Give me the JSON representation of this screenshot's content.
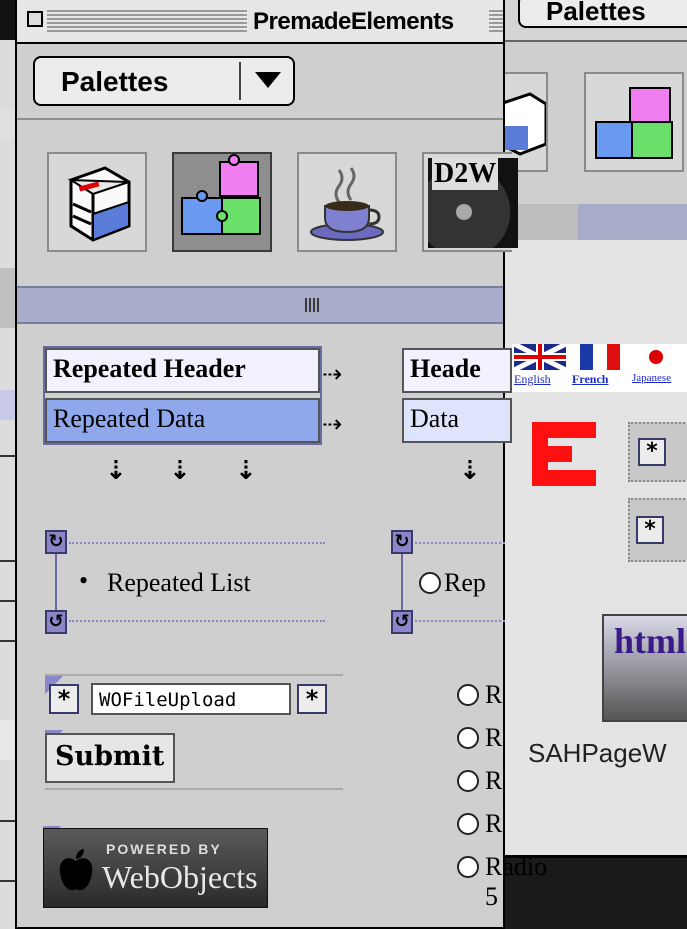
{
  "window": {
    "title": "PremadeElements"
  },
  "palette_dropdown": {
    "selected": "Palettes"
  },
  "toolbar": {
    "icons": [
      "database-cube-icon",
      "puzzle-pieces-icon",
      "java-coffee-cup-icon",
      "d2w-web-icon"
    ],
    "d2w_label": "D2W"
  },
  "repetition": {
    "header_label": "Repeated Header",
    "data_label": "Repeated Data",
    "header2_label": "Heade",
    "data2_label": "Data"
  },
  "repeated_list": {
    "item_label": "Repeated List",
    "item2_label": "Rep"
  },
  "file_upload": {
    "field_value": "WOFileUpload",
    "submit_label": "Submit"
  },
  "radio_group": {
    "items": [
      "R",
      "R",
      "R",
      "R",
      "Radio 5"
    ]
  },
  "badge": {
    "powered_by": "POWERED BY",
    "brand": "WebObjects"
  },
  "second_window": {
    "button_label": "Palettes",
    "flags": [
      "English",
      "French",
      "Japanese"
    ],
    "html_label": "html",
    "component_label": "SAHPageW"
  },
  "colors": {
    "window_bg": "#cfcfcf",
    "data_row": "#8fa8ec",
    "splitter": "#a8acc8",
    "accent_purple": "#8a86c8",
    "red_element": "#ff1010"
  }
}
